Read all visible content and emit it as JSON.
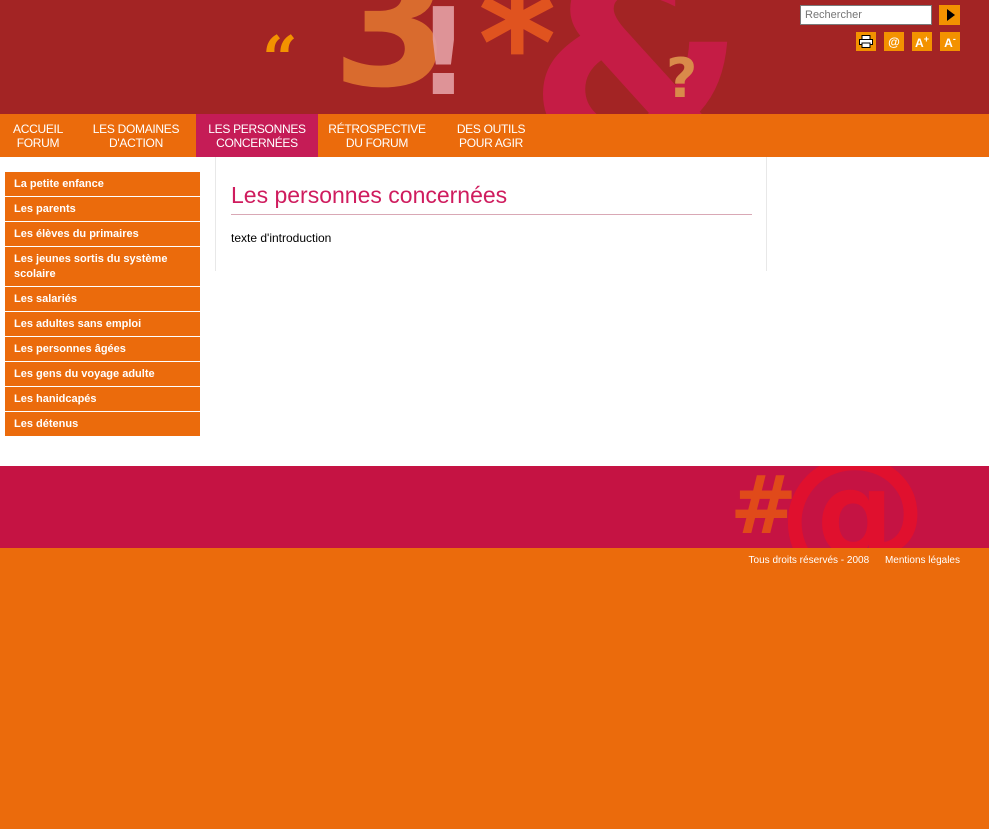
{
  "header": {
    "decor_glyphs": [
      "“",
      "3",
      "!",
      "*",
      "&",
      "?"
    ],
    "search": {
      "placeholder": "Rechercher"
    },
    "tools": [
      {
        "icon": "print-icon",
        "symbol": "⎙"
      },
      {
        "icon": "email-icon",
        "symbol": "@"
      },
      {
        "icon": "font-increase-icon",
        "symbol": "A+"
      },
      {
        "icon": "font-decrease-icon",
        "symbol": "A-"
      }
    ]
  },
  "nav": {
    "items": [
      {
        "line1": "ACCUEIL",
        "line2": "FORUM"
      },
      {
        "line1": "LES DOMAINES",
        "line2": "D'ACTION"
      },
      {
        "line1": "LES PERSONNES",
        "line2": "CONCERNÉES"
      },
      {
        "line1": "RÉTROSPECTIVE",
        "line2": "DU FORUM"
      },
      {
        "line1": "DES OUTILS",
        "line2": "POUR AGIR"
      }
    ],
    "active_index": 2
  },
  "sidebar": {
    "items": [
      "La petite enfance",
      "Les parents",
      "Les élèves du primaires",
      "Les jeunes sortis du système scolaire",
      "Les salariés",
      "Les adultes sans emploi",
      "Les personnes âgées",
      "Les gens du voyage adulte",
      "Les hanidcapés",
      "Les détenus"
    ]
  },
  "main": {
    "title": "Les personnes concernées",
    "intro": "texte d'introduction"
  },
  "footer": {
    "decor_glyphs": [
      "#",
      "@"
    ],
    "copyright": "Tous droits réservés - 2008",
    "legal": "Mentions légales"
  },
  "colors": {
    "header_bg": "#a32424",
    "orange": "#eb6b0c",
    "accent_pink": "#c51c56",
    "title_pink": "#cf1c5e",
    "footer_band": "#c51343"
  }
}
